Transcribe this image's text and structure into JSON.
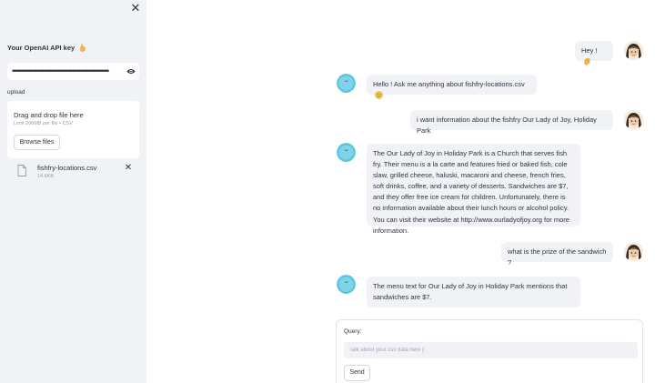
{
  "sidebar": {
    "close_icon": "close-icon",
    "api_key_label": "Your OpenAI API key",
    "api_key_emoji": "pointing-hand-emoji",
    "api_key_value": "••••••••••••••••••••••••••••••••••••••••••••••••••••••••••••••••",
    "eye_icon": "eye-icon",
    "upload_label": "upload",
    "dropzone_title": "Drag and drop file here",
    "dropzone_subtitle": "Limit 200MB per file • CSV",
    "browse_label": "Browse files",
    "file": {
      "name": "fishfry-locations.csv",
      "size": "14.6KB",
      "icon": "file-icon",
      "remove_icon": "close-icon"
    }
  },
  "messages": [
    {
      "role": "user",
      "text": "Hey ! ",
      "emoji": "waving-hand-emoji"
    },
    {
      "role": "assistant",
      "text": "Hello ! Ask me anything about fishfry-locations.csv ",
      "emoji": "hugging-face-emoji"
    },
    {
      "role": "user",
      "text": "i want information about the fishfry Our Lady of Joy, Holiday Park"
    },
    {
      "role": "assistant",
      "text": "The Our Lady of Joy in Holiday Park is a Church that serves fish fry. Their menu is a la carte and features fried or baked fish, cole slaw, grilled cheese, haluski, macaroni and cheese, french fries, soft drinks, coffee, and a variety of desserts. Sandwiches are $7, and they offer free ice cream for children. Unfortunately, there is no information available about their lunch hours or alcohol policy. You can visit their website at http://www.ourladyofjoy.org for more information."
    },
    {
      "role": "user",
      "text": "what is the prize of the sandwich ?"
    },
    {
      "role": "assistant",
      "text": "The menu text for Our Lady of Joy in Holiday Park mentions that sandwiches are $7."
    }
  ],
  "query": {
    "label": "Query:",
    "placeholder": "Talk about your csv data here (:",
    "value": "",
    "send_label": "Send"
  },
  "colors": {
    "sidebar_bg": "#f0f2f6",
    "bubble_bg": "#f0f2f6",
    "text": "#31333f",
    "assistant_avatar": "#5cc6e0"
  }
}
